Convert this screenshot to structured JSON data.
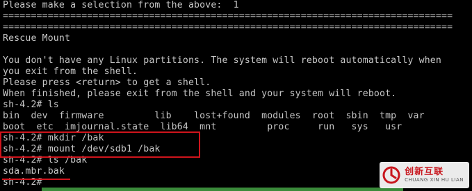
{
  "terminal": {
    "lines": [
      "Please make a selection from the above:  1",
      "================================================================================",
      "================================================================================",
      "Rescue Mount",
      "",
      "You don't have any Linux partitions. The system will reboot automatically when",
      "you exit from the shell.",
      "Please press <return> to get a shell.",
      "When finished, please exit from the shell and your system will reboot.",
      "sh-4.2# ls",
      "bin  dev  firmware         lib    lost+found  modules  root  sbin  tmp  var",
      "boot  etc  imjournal.state  lib64  mnt         proc     run   sys   usr",
      "sh-4.2# mkdir /bak",
      "sh-4.2# mount /dev/sdb1 /bak",
      "sh-4.2# ls /bak",
      "sda.mbr.bak",
      "sh-4.2#"
    ]
  },
  "watermark": {
    "brand_cn": "创新互联",
    "brand_en": "CHUANG XIN HU LIAN"
  },
  "colors": {
    "background": "#000000",
    "text": "#c7c7c7",
    "annotation": "#d0141c",
    "brand": "#c8161d"
  }
}
